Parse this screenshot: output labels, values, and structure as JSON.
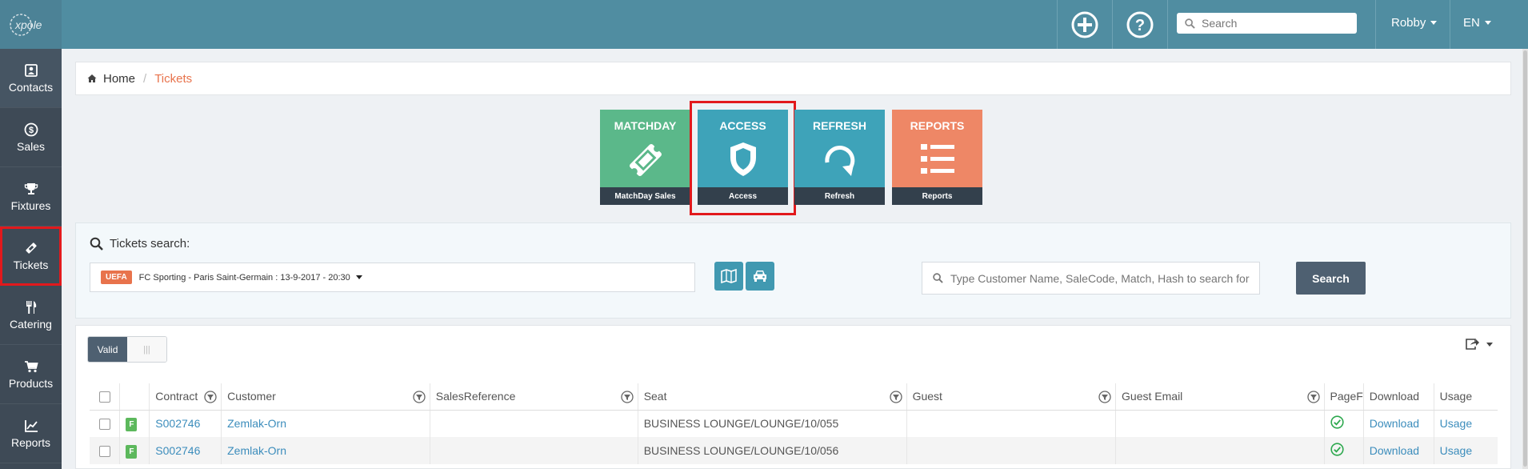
{
  "topbar": {
    "search_placeholder": "Search",
    "user": "Robby",
    "language": "EN"
  },
  "sidebar": {
    "items": [
      {
        "label": "Contacts",
        "icon": "contact-card-icon"
      },
      {
        "label": "Sales",
        "icon": "dollar-icon"
      },
      {
        "label": "Fixtures",
        "icon": "trophy-icon"
      },
      {
        "label": "Tickets",
        "icon": "ticket-icon"
      },
      {
        "label": "Catering",
        "icon": "cutlery-icon"
      },
      {
        "label": "Products",
        "icon": "cart-icon"
      },
      {
        "label": "Reports",
        "icon": "chart-icon"
      }
    ]
  },
  "breadcrumb": {
    "home": "Home",
    "sep": "/",
    "current": "Tickets"
  },
  "tiles": [
    {
      "title": "MATCHDAY",
      "footer": "MatchDay Sales",
      "color": "#5bb88a"
    },
    {
      "title": "ACCESS",
      "footer": "Access",
      "color": "#3ea3b9"
    },
    {
      "title": "REFRESH",
      "footer": "Refresh",
      "color": "#3ea3b9"
    },
    {
      "title": "REPORTS",
      "footer": "Reports",
      "color": "#ee8766"
    }
  ],
  "search_panel": {
    "title": "Tickets search:",
    "badge": "UEFA",
    "match": "FC Sporting - Paris Saint-Germain : 13-9-2017 - 20:30",
    "customer_placeholder": "Type Customer Name, SaleCode, Match, Hash to search for",
    "search_button": "Search"
  },
  "table": {
    "toggle_on": "Valid",
    "toggle_off": "|||",
    "headers": [
      "Contract",
      "Customer",
      "SalesReference",
      "Seat",
      "Guest",
      "Guest Email",
      "PageF",
      "Download",
      "Usage"
    ],
    "rows": [
      {
        "badge": "F",
        "contract": "S002746",
        "customer": "Zemlak-Orn",
        "sales_reference": "",
        "seat": "BUSINESS LOUNGE/LOUNGE/10/055",
        "guest": "",
        "guest_email": "",
        "download": "Download",
        "usage": "Usage"
      },
      {
        "badge": "F",
        "contract": "S002746",
        "customer": "Zemlak-Orn",
        "sales_reference": "",
        "seat": "BUSINESS LOUNGE/LOUNGE/10/056",
        "guest": "",
        "guest_email": "",
        "download": "Download",
        "usage": "Usage"
      }
    ]
  }
}
